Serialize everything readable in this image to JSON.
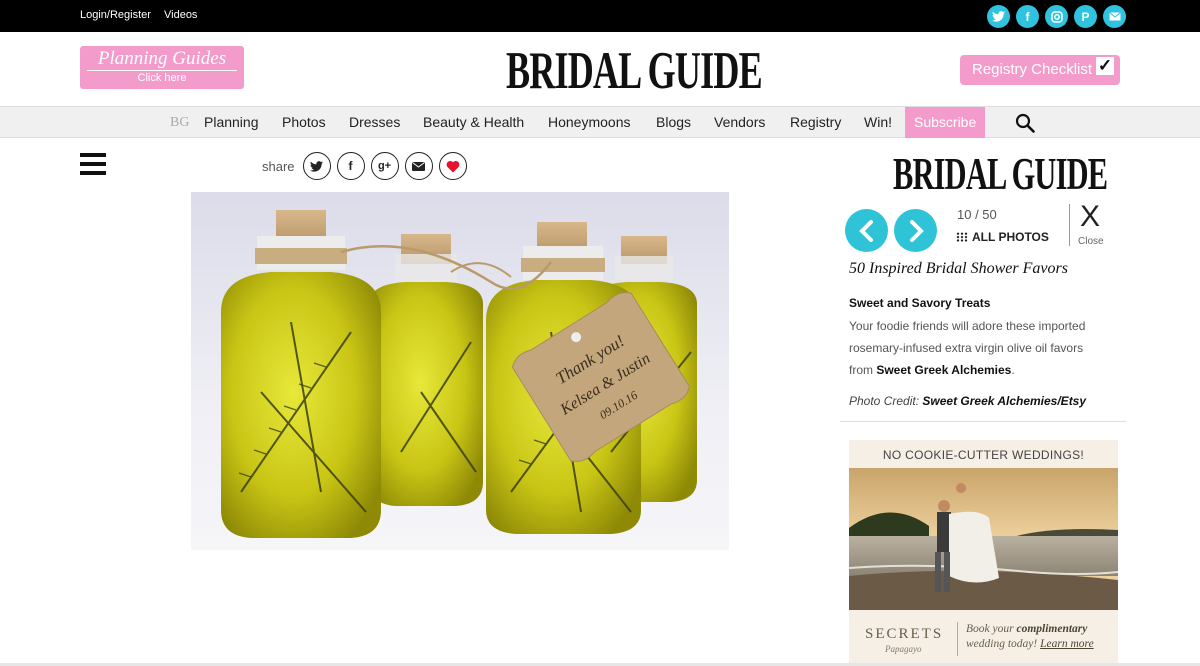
{
  "topbar": {
    "login_label": "Login/Register",
    "videos_label": "Videos",
    "social_icons": [
      "twitter-icon",
      "facebook-icon",
      "instagram-icon",
      "pinterest-icon",
      "email-icon"
    ]
  },
  "header": {
    "logo": "BRIDAL GUIDE",
    "planning_guides": {
      "title": "Planning Guides",
      "subtitle": "Click here"
    },
    "registry_checklist": "Registry Checklist"
  },
  "nav": {
    "bg_mark": "BG",
    "items": [
      "Planning",
      "Photos",
      "Dresses",
      "Beauty & Health",
      "Honeymoons",
      "Blogs",
      "Vendors",
      "Registry",
      "Win!"
    ],
    "subscribe": "Subscribe"
  },
  "share": {
    "label": "share"
  },
  "gallery": {
    "logo": "BRIDAL GUIDE",
    "counter": "10 / 50",
    "all_photos": "ALL PHOTOS",
    "close_symbol": "X",
    "close_label": "Close",
    "title": "50 Inspired Bridal Shower Favors",
    "item_title": "Sweet and Savory Treats",
    "desc_text": "Your foodie friends will adore these imported rosemary-infused extra virgin olive oil favors from ",
    "desc_link": "Sweet Greek Alchemies",
    "desc_end": ".",
    "credit_label": "Photo Credit:",
    "credit_value": "Sweet Greek Alchemies/Etsy"
  },
  "photo": {
    "tag_line1": "Thank you!",
    "tag_line2": "Kelsea & Justin",
    "tag_line3": "09.10.16"
  },
  "ad": {
    "headline": "NO COOKIE-CUTTER WEDDINGS!",
    "brand": "SECRETS",
    "brand_sub": "Papagayo",
    "cta_prefix": "Book your",
    "cta_bold": "complimentary",
    "cta_mid": "wedding today!",
    "cta_link": "Learn more"
  },
  "colors": {
    "pink": "#f39ccb",
    "teal": "#2fc3d8",
    "black": "#000000"
  }
}
